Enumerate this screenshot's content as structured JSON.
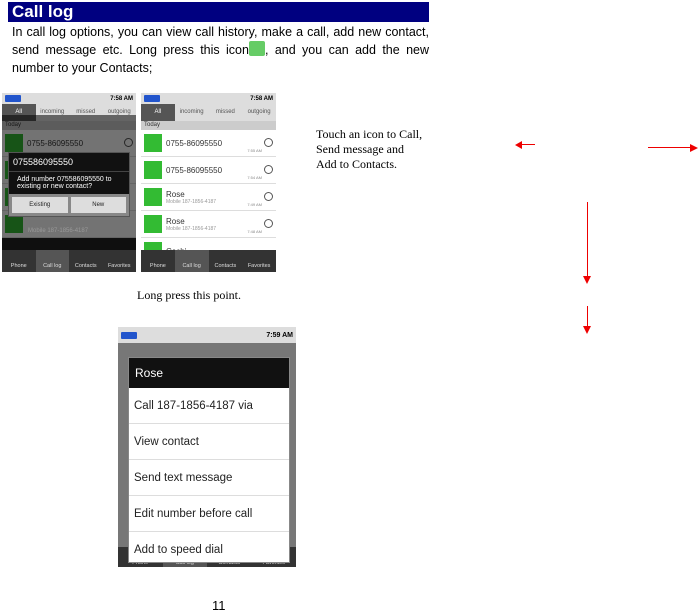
{
  "section": {
    "title": "Call log",
    "intro_before": "In call log options, you can view call history, make a call, add new contact, send message etc. Long press this icon",
    "intro_after": ", and you can add the new number to your Contacts;"
  },
  "status": {
    "time1": "7:58 AM",
    "time2": "7:58 AM",
    "time3": "7:59 AM"
  },
  "tabs": [
    "All",
    "incoming",
    "missed",
    "outgoing"
  ],
  "today": "Today",
  "nav": [
    "Phone",
    "Call log",
    "Contacts",
    "Favorites"
  ],
  "list": [
    {
      "name": "0755-86095550",
      "sub": "",
      "time": "7:55 AM"
    },
    {
      "name": "0755-86095550",
      "sub": "",
      "time": "7:54 AM"
    },
    {
      "name": "Rose",
      "sub": "Mobile 187-1856-4187",
      "time": "7:49 AM"
    },
    {
      "name": "Rose",
      "sub": "Mobile 187-1856-4187",
      "time": "7:48 AM"
    },
    {
      "name": "Cechi",
      "sub": "",
      "time": ""
    }
  ],
  "dialog": {
    "title": "075586095550",
    "message": "Add number 075586095550 to existing or new contact?",
    "existing": "Existing",
    "new": "New"
  },
  "menu": {
    "title": "Rose",
    "items": [
      "Call 187-1856-4187 via",
      "View contact",
      "Send text message",
      "Edit number before call",
      "Add to speed dial"
    ]
  },
  "captions": {
    "touch": "Touch an icon to Call, Send message and Add to Contacts.",
    "long_press": "Long press this point."
  },
  "page_number": "11",
  "colors": {
    "header_bg": "#000080",
    "arrow": "#e00000",
    "contact_icon": "#33bb33"
  }
}
